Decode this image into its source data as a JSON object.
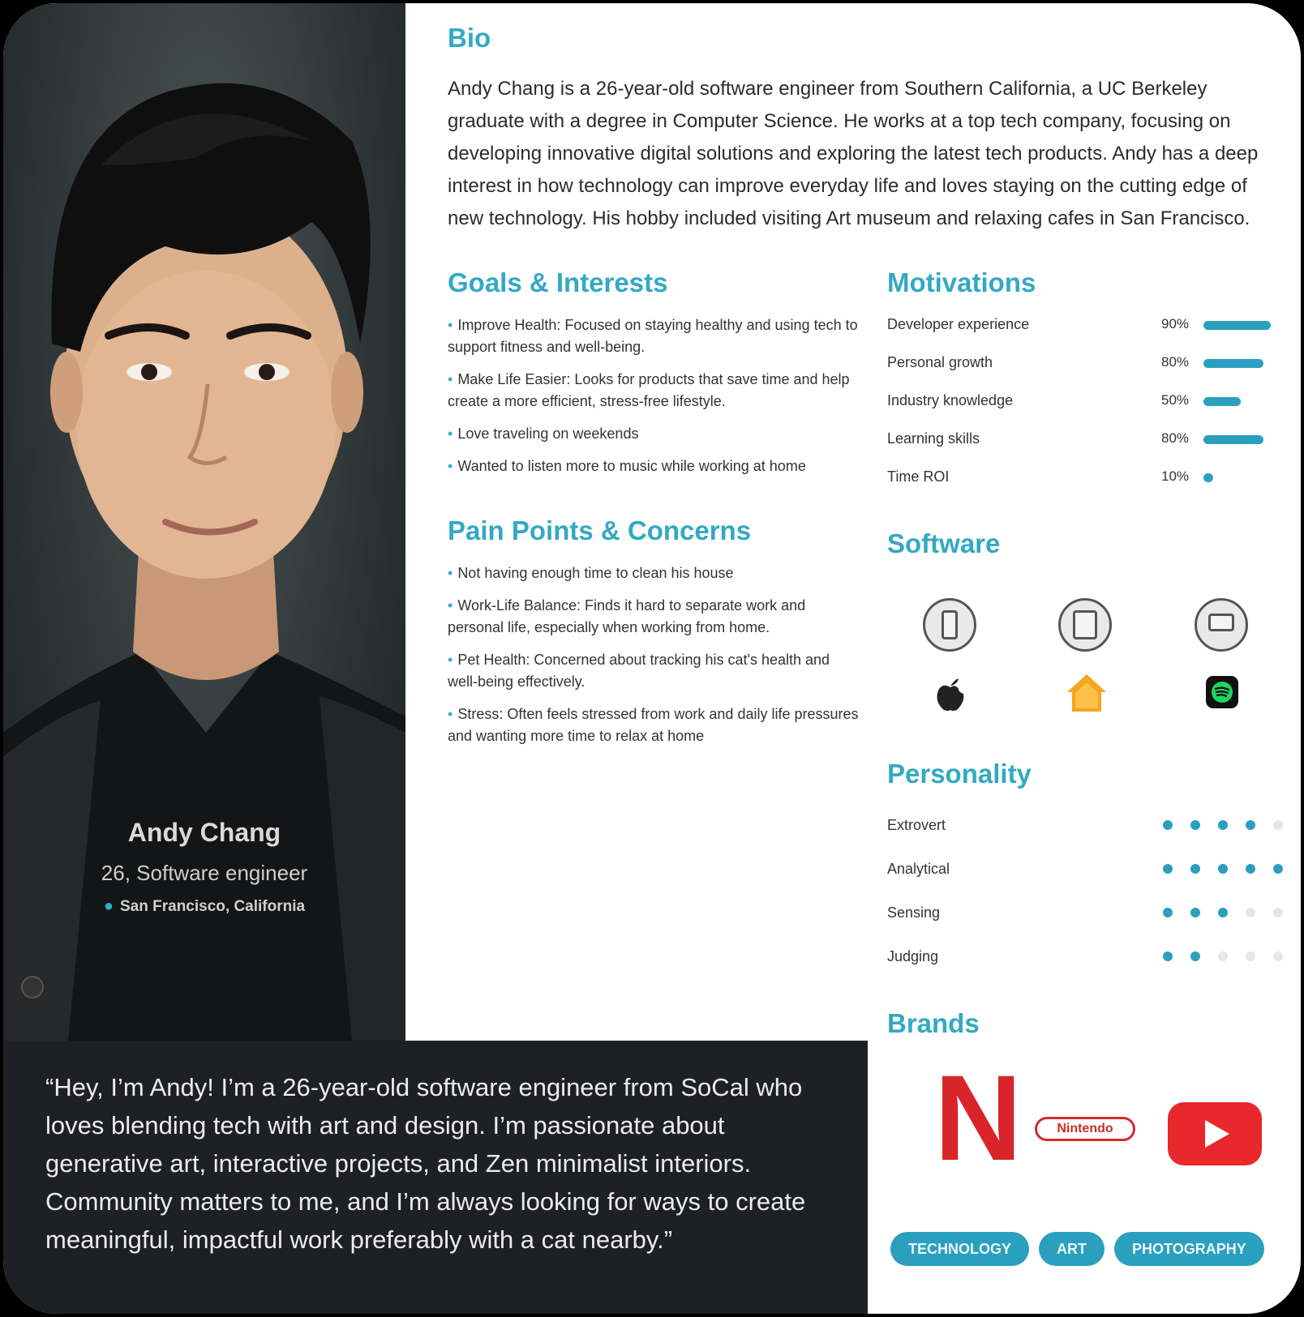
{
  "profile": {
    "name": "Andy Chang",
    "role": "26, Software engineer",
    "location": "San Francisco, California",
    "location_icon": "map-pin-icon"
  },
  "bio": {
    "heading": "Bio",
    "text": "Andy Chang is a 26-year-old software engineer from Southern California, a UC Berkeley graduate with a degree in Computer Science. He works at a top tech company, focusing on developing innovative digital solutions and exploring the latest tech products. Andy has a deep interest in how technology can improve everyday life and loves staying on the cutting edge of new technology. His hobby included visiting Art museum and relaxing cafes in San Francisco."
  },
  "goals": {
    "heading": "Goals & Interests",
    "items": [
      "Improve Health: Focused on staying healthy and using tech to support fitness and well-being.",
      "Make Life Easier: Looks for products that save time and help create a more efficient, stress-free lifestyle.",
      "Love traveling on weekends",
      "Wanted to listen more to music while working at home"
    ]
  },
  "pain_points": {
    "heading": "Pain Points & Concerns",
    "items": [
      "Not having enough time to clean his house",
      "Work-Life Balance: Finds it hard to separate work and personal life, especially when working from home.",
      "Pet Health: Concerned about tracking his cat's health and well-being effectively.",
      "Stress: Often feels stressed from work and daily life pressures and wanting more time to relax at home"
    ]
  },
  "motivations": {
    "heading": "Motivations",
    "items": [
      {
        "label": "Developer experience",
        "percent": "90%",
        "value": 0.9
      },
      {
        "label": "Personal growth",
        "percent": "80%",
        "value": 0.8
      },
      {
        "label": "Industry knowledge",
        "percent": "50%",
        "value": 0.5
      },
      {
        "label": "Learning skills",
        "percent": "80%",
        "value": 0.8
      },
      {
        "label": "Time ROI",
        "percent": "10%",
        "value": 0.1
      }
    ]
  },
  "software": {
    "heading": "Software",
    "devices": [
      "phone-icon",
      "tablet-icon",
      "laptop-icon"
    ],
    "apps": [
      "apple-icon",
      "home-icon",
      "spotify-icon"
    ]
  },
  "personality": {
    "heading": "Personality",
    "items": [
      {
        "label": "Extrovert",
        "level": 4,
        "max": 5
      },
      {
        "label": "Analytical",
        "level": 5,
        "max": 5
      },
      {
        "label": "Sensing",
        "level": 3,
        "max": 5
      },
      {
        "label": "Judging",
        "level": 2,
        "max": 5
      }
    ]
  },
  "brands": {
    "heading": "Brands",
    "netflix_mark": "N",
    "nintendo_mark": "Nintendo",
    "youtube_icon": "youtube-icon"
  },
  "tags": [
    "TECHNOLOGY",
    "ART",
    "PHOTOGRAPHY"
  ],
  "quote": {
    "mark": "“",
    "text": "“Hey, I’m Andy! I’m a 26-year-old software engineer from SoCal who loves blending tech with art and design. I’m passionate about generative art, interactive projects, and Zen minimalist interiors. Community matters to me, and I’m always looking for ways to create meaningful, impactful work preferably with a cat nearby.”"
  },
  "colors": {
    "accent": "#2b9fbe",
    "heading": "#33a9c3",
    "quote_bg": "#1e2025",
    "dot_off": "#e4e6e8"
  }
}
